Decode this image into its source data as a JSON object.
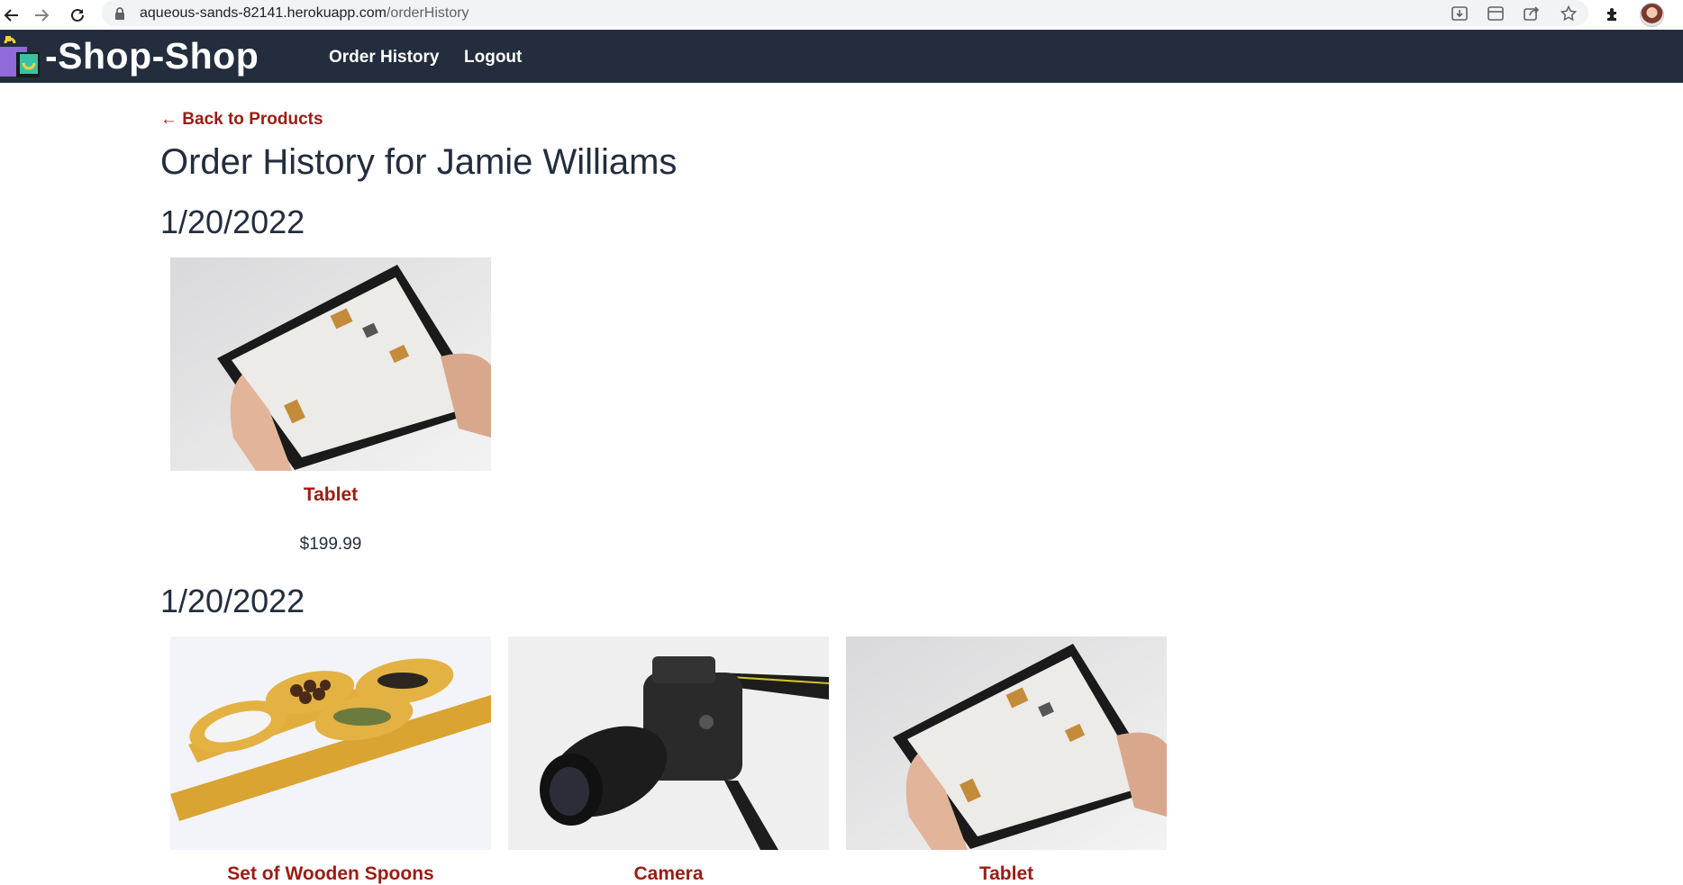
{
  "browser": {
    "url_host": "aqueous-sands-82141.herokuapp.com",
    "url_path": "/orderHistory",
    "icons": [
      "back-arrow-icon",
      "forward-arrow-icon",
      "reload-icon",
      "lock-icon",
      "install-icon",
      "tab-search-icon",
      "share-icon",
      "star-icon",
      "extensions-icon",
      "profile-avatar"
    ]
  },
  "header": {
    "brand": "-Shop-Shop",
    "nav": {
      "order_history": "Order History",
      "logout": "Logout"
    }
  },
  "page": {
    "back_link": "← Back to Products",
    "title": "Order History for Jamie Williams"
  },
  "orders": [
    {
      "date": "1/20/2022",
      "items": [
        {
          "name": "Tablet",
          "price": "$199.99",
          "image": "tablet-photo"
        }
      ]
    },
    {
      "date": "1/20/2022",
      "items": [
        {
          "name": "Set of Wooden Spoons",
          "image": "wooden-spoons-photo"
        },
        {
          "name": "Camera",
          "image": "camera-photo"
        },
        {
          "name": "Tablet",
          "image": "tablet-photo"
        }
      ]
    }
  ],
  "colors": {
    "header_bg": "#232d3d",
    "link_red": "#9b1c13",
    "text_dark": "#232d3d"
  }
}
